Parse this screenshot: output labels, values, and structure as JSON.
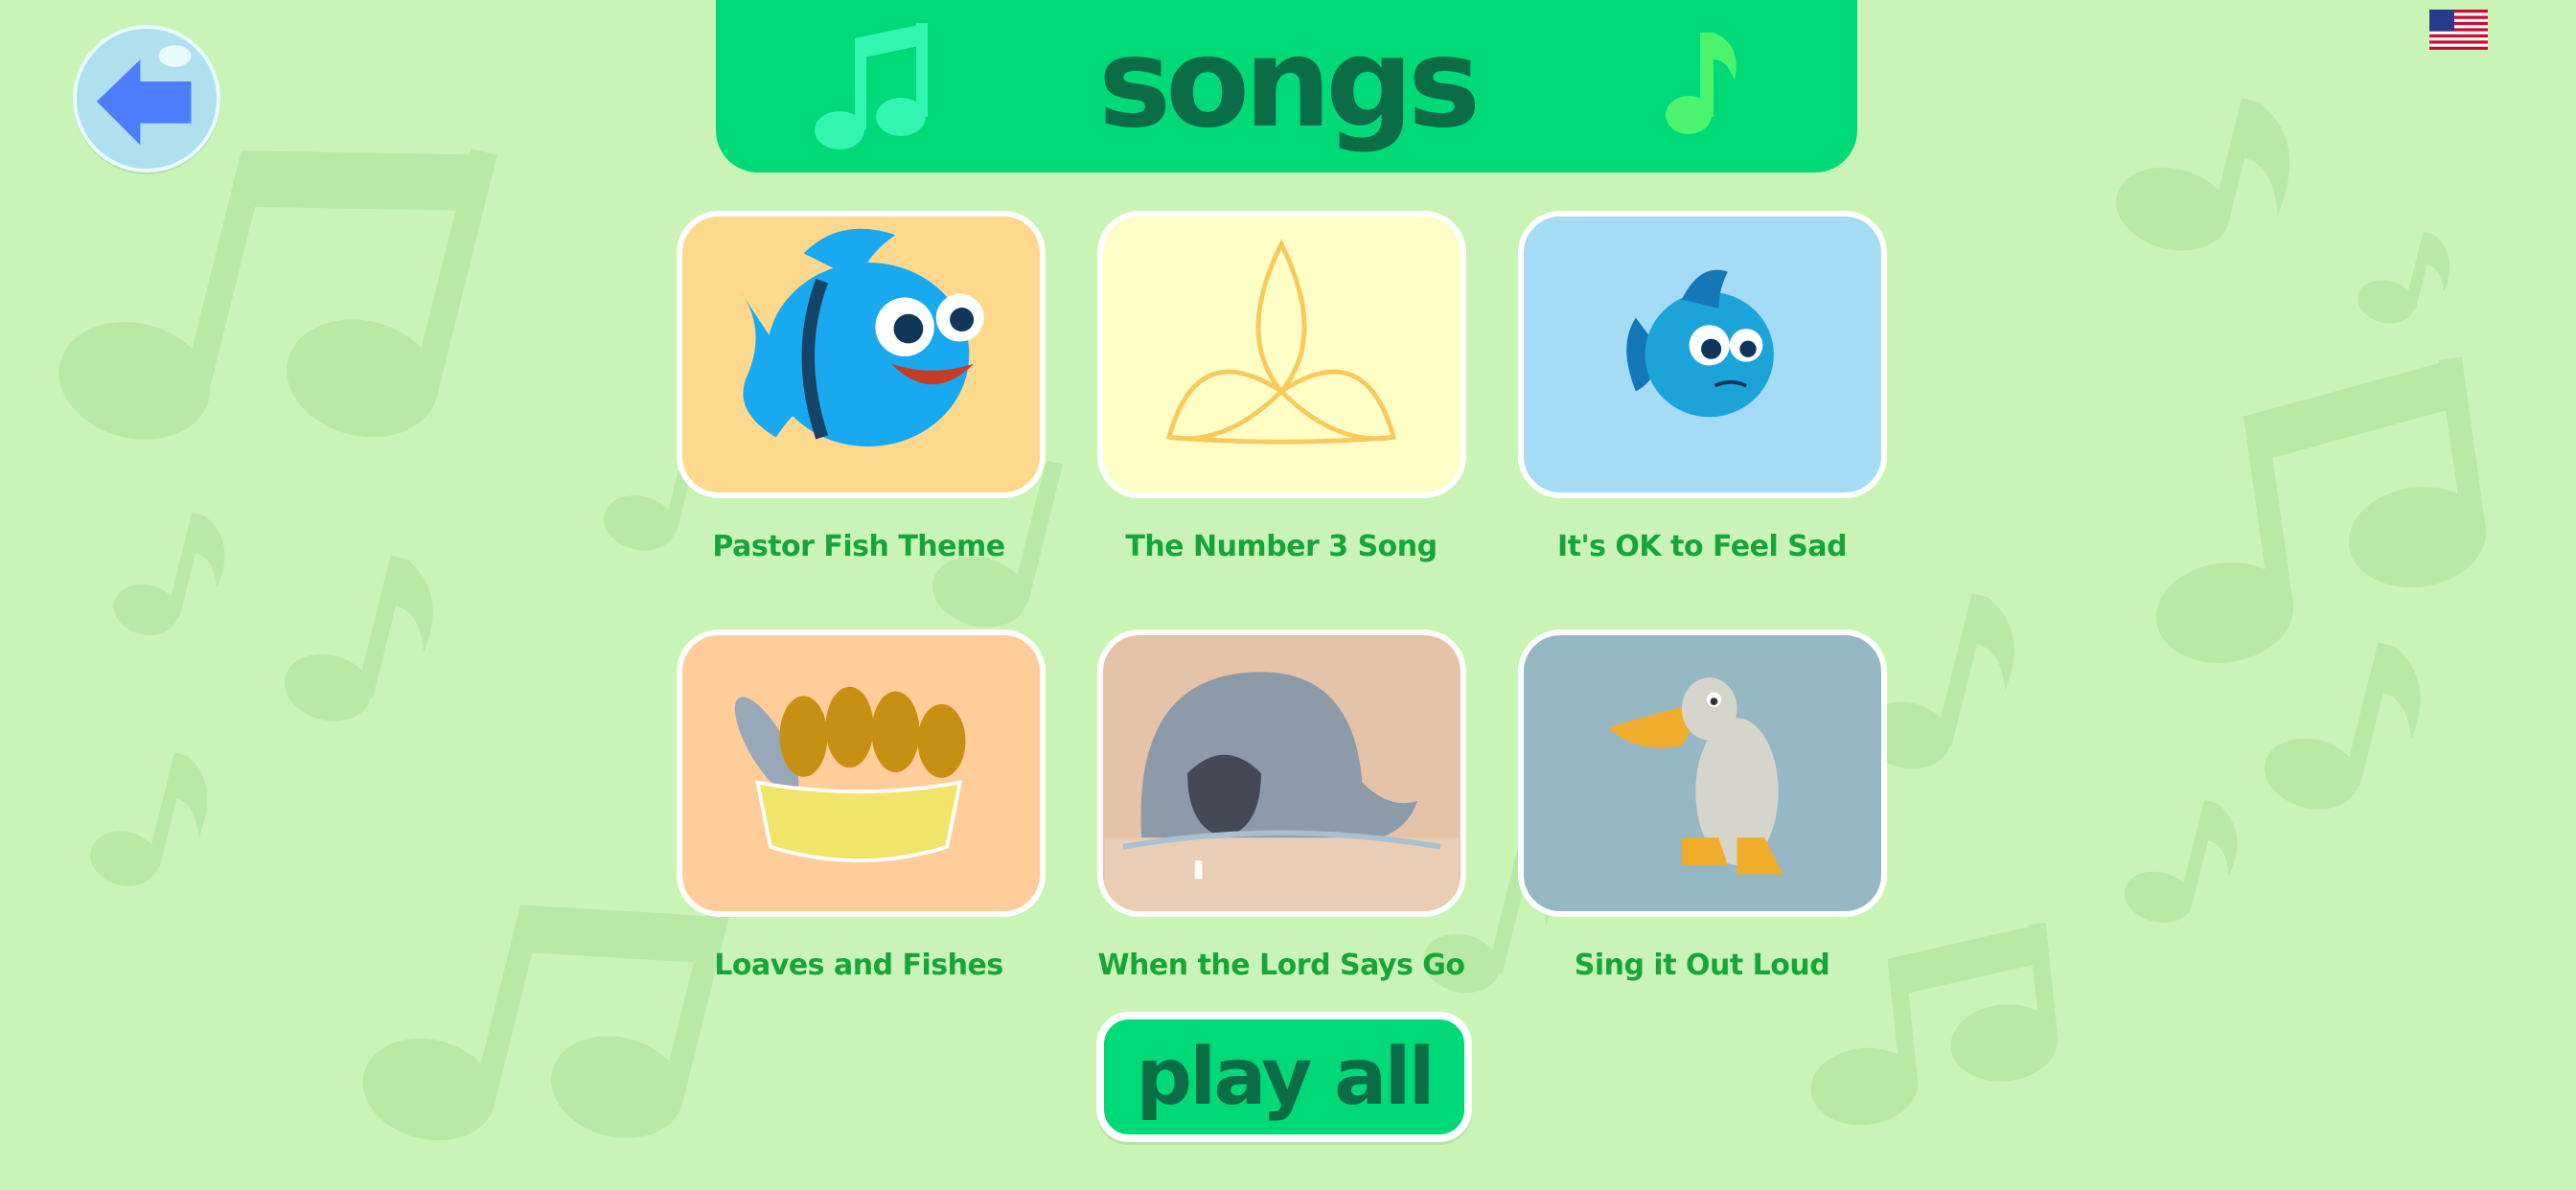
{
  "header": {
    "title": "songs"
  },
  "nav": {
    "back_icon": "back-arrow-icon",
    "language_icon": "us-flag-icon"
  },
  "songs": [
    {
      "label": "Pastor Fish Theme",
      "icon": "blue-fish-happy"
    },
    {
      "label": "The Number 3 Song",
      "icon": "trinity-knot"
    },
    {
      "label": "It's OK to Feel Sad",
      "icon": "blue-fish-sad"
    },
    {
      "label": "Loaves and Fishes",
      "icon": "bread-basket"
    },
    {
      "label": "When the Lord Says Go",
      "icon": "whale"
    },
    {
      "label": "Sing it Out Loud",
      "icon": "duck"
    }
  ],
  "play_all": {
    "label": "play all"
  },
  "colors": {
    "background": "#c9f4b6",
    "header": "#00d978",
    "title_text": "#0a6d46",
    "label_text": "#17a53a"
  }
}
